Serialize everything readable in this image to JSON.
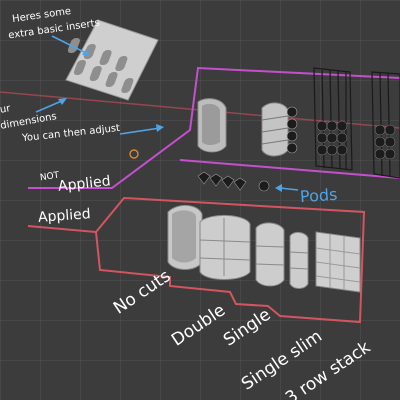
{
  "viewport": {
    "background": "#3c3c3c",
    "grid_color": "#505050",
    "x_axis_color": "#b34a55"
  },
  "annotations": {
    "heres_line1": "Heres some",
    "heres_line2": "extra basic inserts",
    "dimensions_left": "ur",
    "dimensions_right": "dimensions",
    "adjust": "You can then adjust",
    "not_small": "NOT",
    "applied_top": "Applied",
    "applied": "Applied",
    "pods": "Pods",
    "no_cuts": "No cuts",
    "double": "Double",
    "single": "Single",
    "single_slim": "Single slim",
    "three_row_stack": "3 row stack"
  },
  "colors": {
    "text": "#ffffff",
    "arrow": "#4fa3e6",
    "pods_text": "#4fa3e6",
    "outline_magenta": "#c64fd0",
    "outline_red": "#d2555f",
    "object_light": "#c8c8c8",
    "object_dark": "#1c1c1c"
  }
}
